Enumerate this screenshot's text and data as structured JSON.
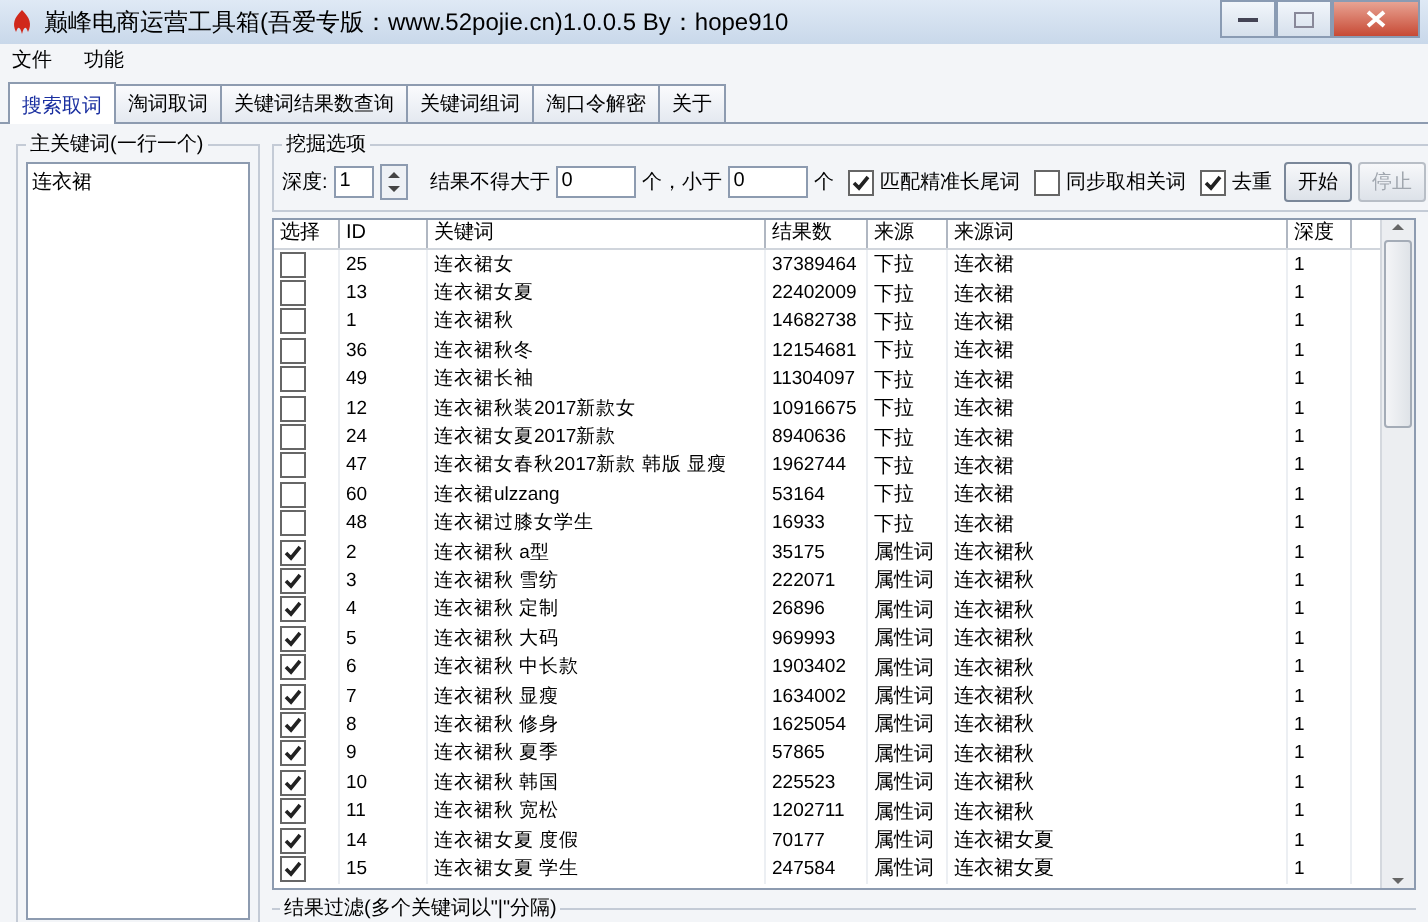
{
  "window": {
    "title": "巅峰电商运营工具箱(吾爱专版：www.52pojie.cn)1.0.0.5 By：hope910"
  },
  "menu": [
    "文件",
    "功能"
  ],
  "tabs": [
    {
      "label": "搜索取词",
      "selected": true
    },
    {
      "label": "淘词取词",
      "selected": false
    },
    {
      "label": "关键词结果数查询",
      "selected": false
    },
    {
      "label": "关键词组词",
      "selected": false
    },
    {
      "label": "淘口令解密",
      "selected": false
    },
    {
      "label": "关于",
      "selected": false
    }
  ],
  "main_keywords": {
    "legend": "主关键词(一行一个)",
    "value": "连衣裙"
  },
  "options": {
    "legend": "挖掘选项",
    "depth_label": "深度:",
    "depth_value": "1",
    "max_label": "结果不得大于",
    "max_value": "0",
    "min_label": "个，小于",
    "min_value": "0",
    "unit": "个",
    "checkboxes": [
      {
        "label": "匹配精准长尾词",
        "checked": true
      },
      {
        "label": "同步取相关词",
        "checked": false
      },
      {
        "label": "去重",
        "checked": true
      }
    ],
    "buttons": [
      {
        "label": "开始",
        "disabled": false
      },
      {
        "label": "停止",
        "disabled": true
      }
    ]
  },
  "table": {
    "columns": [
      "选择",
      "ID",
      "关键词",
      "结果数",
      "来源",
      "来源词",
      "深度"
    ],
    "rows": [
      {
        "checked": false,
        "cells": [
          "",
          "25",
          "连衣裙女",
          "37389464",
          "下拉",
          "连衣裙",
          "1"
        ]
      },
      {
        "checked": false,
        "cells": [
          "",
          "13",
          "连衣裙女夏",
          "22402009",
          "下拉",
          "连衣裙",
          "1"
        ]
      },
      {
        "checked": false,
        "cells": [
          "",
          "1",
          "连衣裙秋",
          "14682738",
          "下拉",
          "连衣裙",
          "1"
        ]
      },
      {
        "checked": false,
        "cells": [
          "",
          "36",
          "连衣裙秋冬",
          "12154681",
          "下拉",
          "连衣裙",
          "1"
        ]
      },
      {
        "checked": false,
        "cells": [
          "",
          "49",
          "连衣裙长袖",
          "11304097",
          "下拉",
          "连衣裙",
          "1"
        ]
      },
      {
        "checked": false,
        "cells": [
          "",
          "12",
          "连衣裙秋装2017新款女",
          "10916675",
          "下拉",
          "连衣裙",
          "1"
        ]
      },
      {
        "checked": false,
        "cells": [
          "",
          "24",
          "连衣裙女夏2017新款",
          "8940636",
          "下拉",
          "连衣裙",
          "1"
        ]
      },
      {
        "checked": false,
        "cells": [
          "",
          "47",
          "连衣裙女春秋2017新款 韩版 显瘦",
          "1962744",
          "下拉",
          "连衣裙",
          "1"
        ]
      },
      {
        "checked": false,
        "cells": [
          "",
          "60",
          "连衣裙ulzzang",
          "53164",
          "下拉",
          "连衣裙",
          "1"
        ]
      },
      {
        "checked": false,
        "cells": [
          "",
          "48",
          "连衣裙过膝女学生",
          "16933",
          "下拉",
          "连衣裙",
          "1"
        ]
      },
      {
        "checked": true,
        "cells": [
          "",
          "2",
          "连衣裙秋 a型",
          "35175",
          "属性词",
          "连衣裙秋",
          "1"
        ]
      },
      {
        "checked": true,
        "cells": [
          "",
          "3",
          "连衣裙秋 雪纺",
          "222071",
          "属性词",
          "连衣裙秋",
          "1"
        ]
      },
      {
        "checked": true,
        "cells": [
          "",
          "4",
          "连衣裙秋 定制",
          "26896",
          "属性词",
          "连衣裙秋",
          "1"
        ]
      },
      {
        "checked": true,
        "cells": [
          "",
          "5",
          "连衣裙秋 大码",
          "969993",
          "属性词",
          "连衣裙秋",
          "1"
        ]
      },
      {
        "checked": true,
        "cells": [
          "",
          "6",
          "连衣裙秋 中长款",
          "1903402",
          "属性词",
          "连衣裙秋",
          "1"
        ]
      },
      {
        "checked": true,
        "cells": [
          "",
          "7",
          "连衣裙秋 显瘦",
          "1634002",
          "属性词",
          "连衣裙秋",
          "1"
        ]
      },
      {
        "checked": true,
        "cells": [
          "",
          "8",
          "连衣裙秋 修身",
          "1625054",
          "属性词",
          "连衣裙秋",
          "1"
        ]
      },
      {
        "checked": true,
        "cells": [
          "",
          "9",
          "连衣裙秋 夏季",
          "57865",
          "属性词",
          "连衣裙秋",
          "1"
        ]
      },
      {
        "checked": true,
        "cells": [
          "",
          "10",
          "连衣裙秋 韩国",
          "225523",
          "属性词",
          "连衣裙秋",
          "1"
        ]
      },
      {
        "checked": true,
        "cells": [
          "",
          "11",
          "连衣裙秋 宽松",
          "1202711",
          "属性词",
          "连衣裙秋",
          "1"
        ]
      },
      {
        "checked": true,
        "cells": [
          "",
          "14",
          "连衣裙女夏 度假",
          "70177",
          "属性词",
          "连衣裙女夏",
          "1"
        ]
      },
      {
        "checked": true,
        "cells": [
          "",
          "15",
          "连衣裙女夏 学生",
          "247584",
          "属性词",
          "连衣裙女夏",
          "1"
        ]
      }
    ]
  },
  "filter": {
    "legend": "结果过滤(多个关键词以\"|\"分隔)"
  }
}
